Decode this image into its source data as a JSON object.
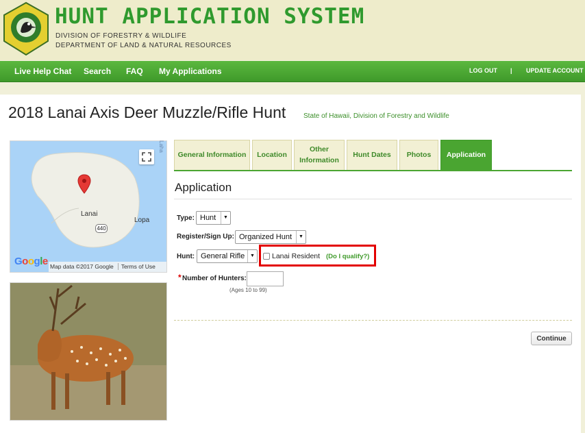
{
  "header": {
    "title": "HUNT APPLICATION SYSTEM",
    "subtitle_1": "DIVISION OF FORESTRY & WILDLIFE",
    "subtitle_2": "DEPARTMENT OF LAND & NATURAL RESOURCES",
    "logo_text_top": "FORESTRY AND WILDLIFE",
    "logo_text_bottom": "HAWAII"
  },
  "nav": {
    "live_help": "Live Help Chat",
    "search": "Search",
    "faq": "FAQ",
    "my_applications": "My Applications",
    "log_out": "LOG OUT",
    "separator": "|",
    "update_account": "UPDATE ACCOUNT"
  },
  "page": {
    "title": "2018 Lanai Axis Deer Muzzle/Rifle Hunt",
    "subtitle": "State of Hawaii, Division of Forestry and Wildlife"
  },
  "map": {
    "label_lanai": "Lanai",
    "label_lopa": "Lopa",
    "route_number": "440",
    "edge_text": "Laha",
    "google_logo": "Google",
    "attribution": "Map data ©2017 Google",
    "terms": "Terms of Use"
  },
  "tabs": [
    {
      "label": "General Information"
    },
    {
      "label": "Location"
    },
    {
      "label": "Other Information"
    },
    {
      "label": "Hunt Dates"
    },
    {
      "label": "Photos"
    },
    {
      "label": "Application"
    }
  ],
  "form": {
    "section_title": "Application",
    "type_label": "Type:",
    "type_value": "Hunt",
    "register_label": "Register/Sign Up:",
    "register_value": "Organized Hunt",
    "hunt_label": "Hunt:",
    "hunt_value": "General Rifle",
    "resident_label": "Lanai Resident",
    "qualify_link": "(Do I qualify?)",
    "required_mark": "*",
    "hunters_label": "Number of Hunters:",
    "hunters_value": "",
    "ages_hint": "(Ages 10 to 99)",
    "continue_label": "Continue"
  },
  "colors": {
    "brand_green": "#4aa531",
    "title_green": "#2f9a2e",
    "highlight_red": "#e30000"
  }
}
